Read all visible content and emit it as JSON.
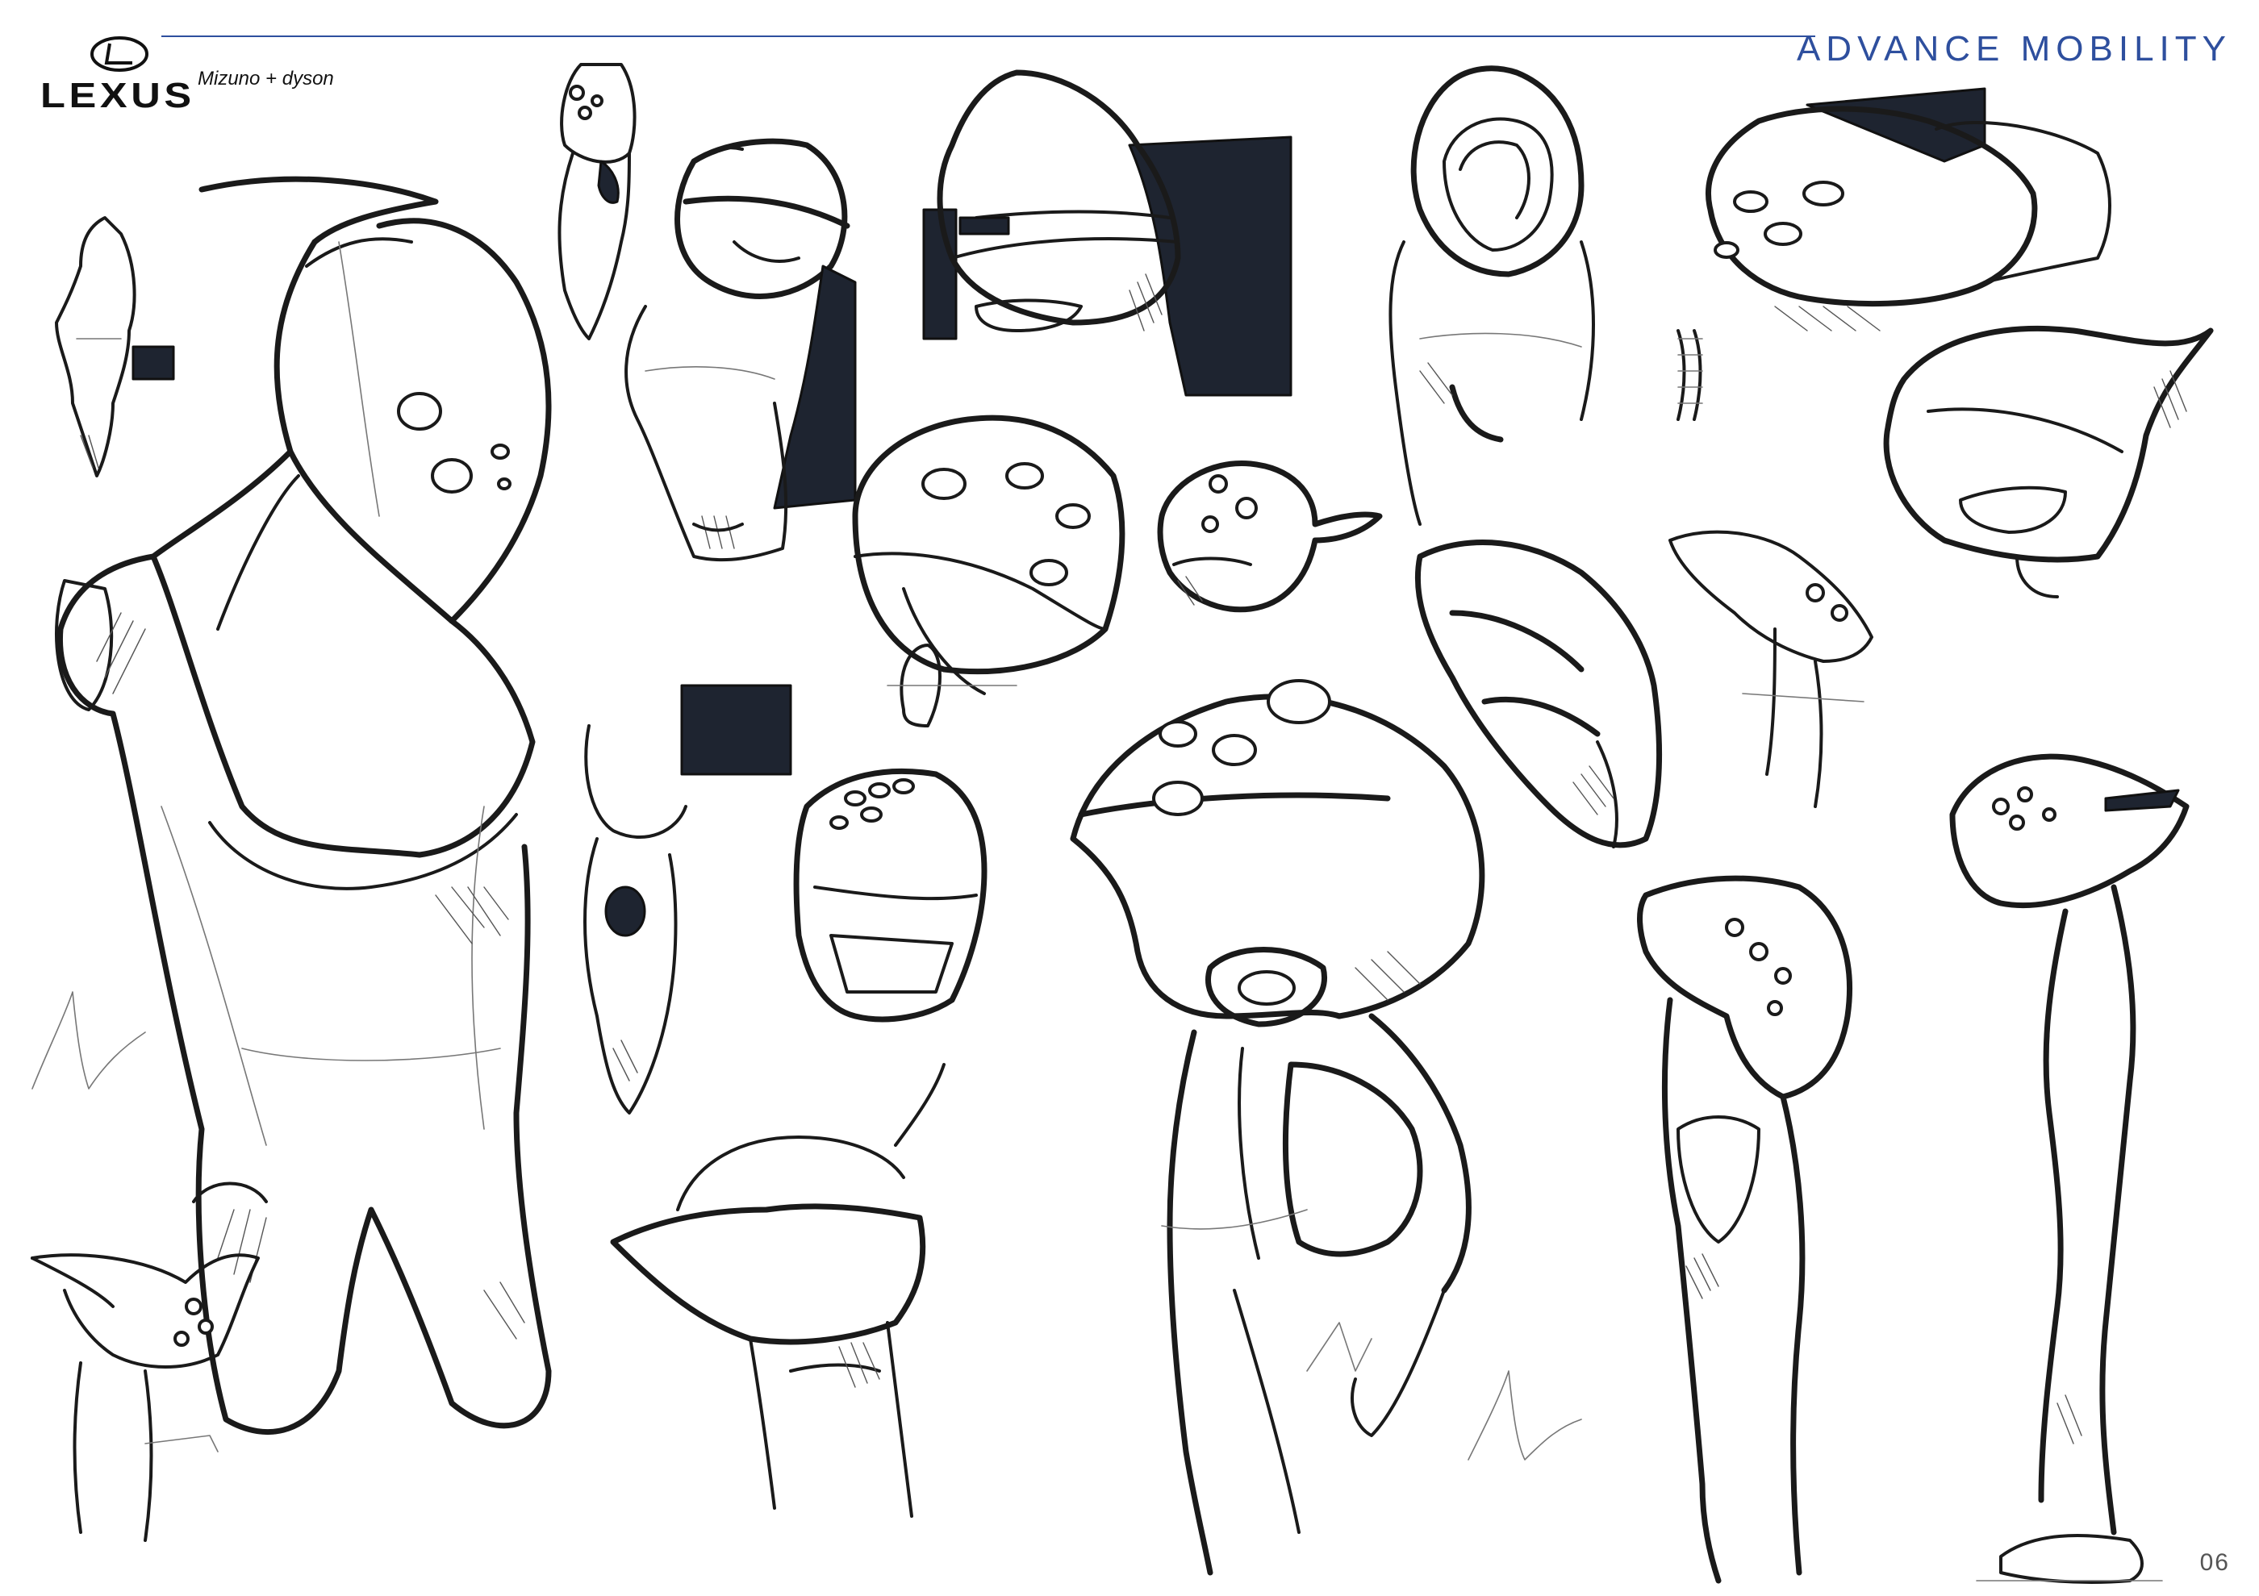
{
  "header": {
    "brand": "LEXUS",
    "partners": "Mizuno + dyson",
    "section_title": "ADVANCE MOBILITY"
  },
  "footer": {
    "page_number": "06"
  },
  "colors": {
    "accent": "#2e4f9e",
    "ink": "#1a1a1a",
    "marker_fill": "#1e2430",
    "background": "#ffffff"
  },
  "icons": {
    "logo": "lexus-logo-icon"
  }
}
